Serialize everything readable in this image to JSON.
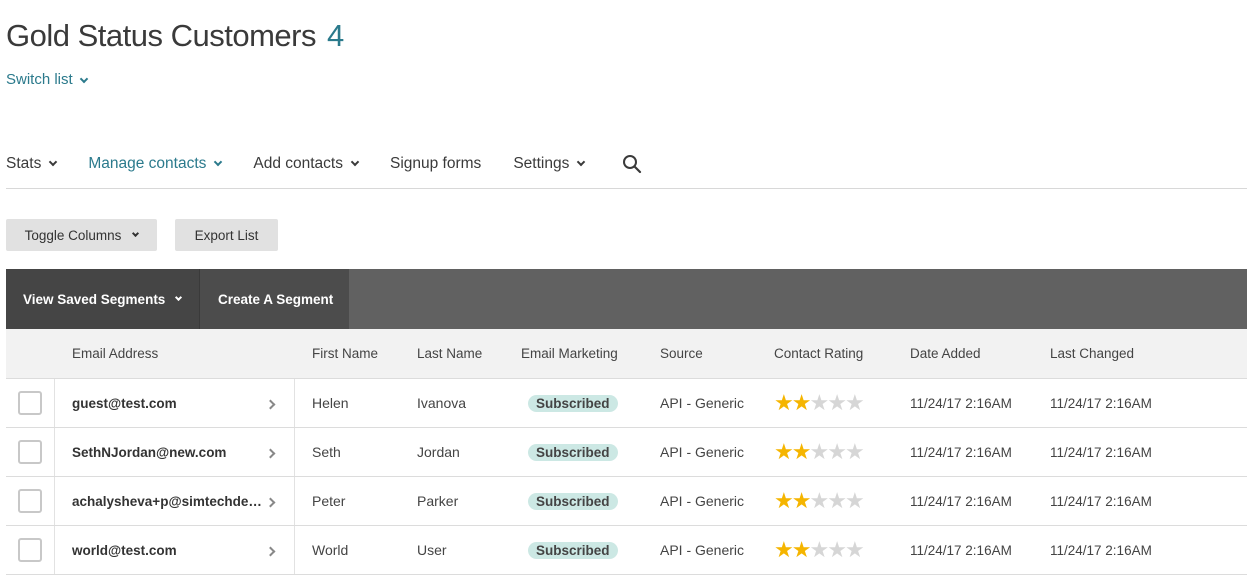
{
  "header": {
    "title": "Gold Status Customers",
    "count": "4",
    "switch_list": "Switch list"
  },
  "nav": {
    "items": [
      {
        "label": "Stats",
        "dropdown": true,
        "active": false
      },
      {
        "label": "Manage contacts",
        "dropdown": true,
        "active": true
      },
      {
        "label": "Add contacts",
        "dropdown": true,
        "active": false
      },
      {
        "label": "Signup forms",
        "dropdown": false,
        "active": false
      },
      {
        "label": "Settings",
        "dropdown": true,
        "active": false
      }
    ],
    "search_icon": "search-icon"
  },
  "toolbar": {
    "toggle_columns": "Toggle Columns",
    "export_list": "Export List"
  },
  "segments": {
    "view_saved": "View Saved Segments",
    "create": "Create A Segment"
  },
  "table": {
    "columns": [
      "Email Address",
      "First Name",
      "Last Name",
      "Email Marketing",
      "Source",
      "Contact Rating",
      "Date Added",
      "Last Changed"
    ],
    "rows": [
      {
        "email": "guest@test.com",
        "first": "Helen",
        "last": "Ivanova",
        "marketing": "Subscribed",
        "source": "API - Generic",
        "rating": 2,
        "added": "11/24/17 2:16AM",
        "changed": "11/24/17 2:16AM"
      },
      {
        "email": "SethNJordan@new.com",
        "first": "Seth",
        "last": "Jordan",
        "marketing": "Subscribed",
        "source": "API - Generic",
        "rating": 2,
        "added": "11/24/17 2:16AM",
        "changed": "11/24/17 2:16AM"
      },
      {
        "email": "achalysheva+p@simtechdev…",
        "first": "Peter",
        "last": "Parker",
        "marketing": "Subscribed",
        "source": "API - Generic",
        "rating": 2,
        "added": "11/24/17 2:16AM",
        "changed": "11/24/17 2:16AM"
      },
      {
        "email": "world@test.com",
        "first": "World",
        "last": "User",
        "marketing": "Subscribed",
        "source": "API - Generic",
        "rating": 2,
        "added": "11/24/17 2:16AM",
        "changed": "11/24/17 2:16AM"
      }
    ],
    "max_rating": 5
  },
  "colors": {
    "accent": "#2b7a8c",
    "star_on": "#f5b500",
    "star_off": "#d6d6d6",
    "badge_bg": "#cce8e4",
    "segment_bar": "#616161"
  }
}
